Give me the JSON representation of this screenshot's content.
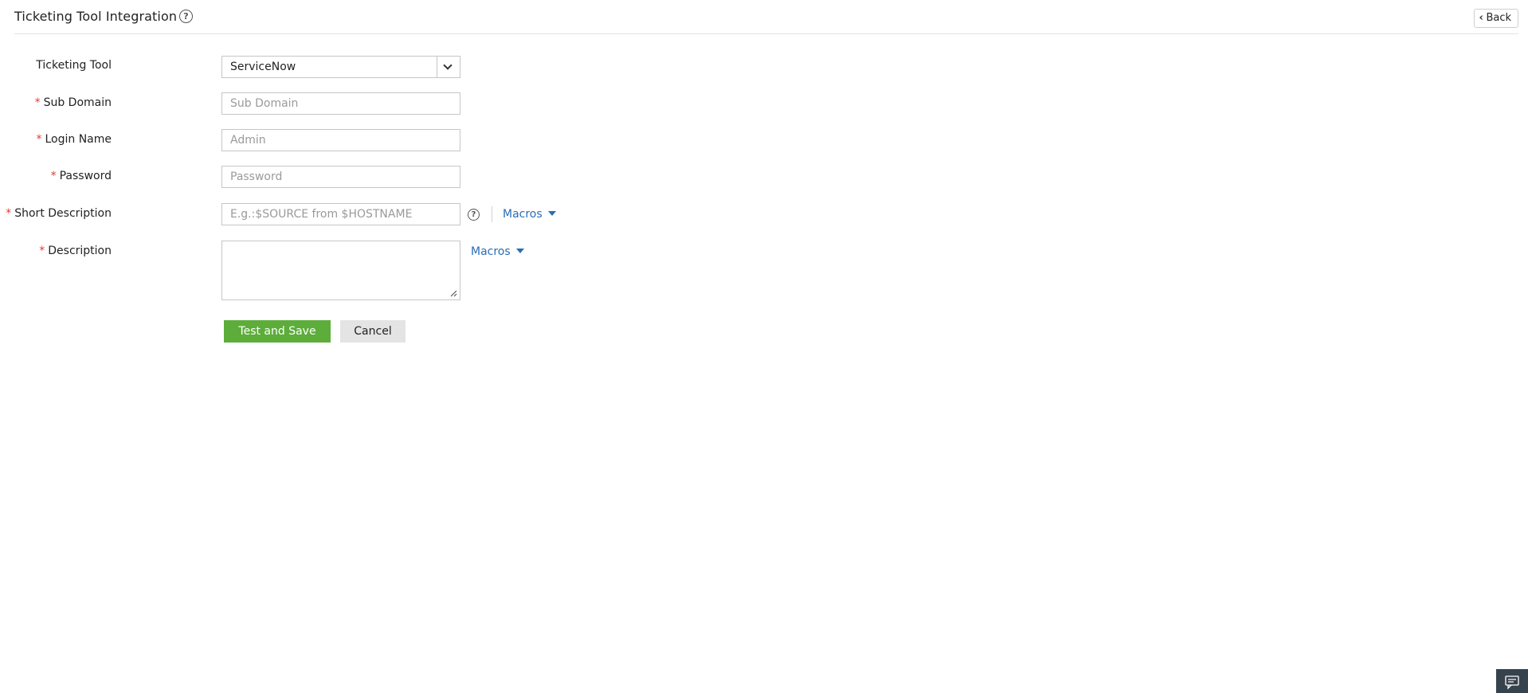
{
  "header": {
    "title": "Ticketing Tool Integration",
    "help_icon": "question-circle-icon",
    "back_label": "Back",
    "back_icon": "chevron-left-icon"
  },
  "form": {
    "ticketing_tool": {
      "label": "Ticketing Tool",
      "value": "ServiceNow"
    },
    "sub_domain": {
      "label": "Sub Domain",
      "required": "*",
      "value": "",
      "placeholder": "Sub Domain"
    },
    "login_name": {
      "label": "Login Name",
      "required": "*",
      "value": "",
      "placeholder": "Admin"
    },
    "password": {
      "label": "Password",
      "required": "*",
      "value": "",
      "placeholder": "Password"
    },
    "short_description": {
      "label": "Short Description",
      "required": "*",
      "value": "",
      "placeholder": "E.g.:$SOURCE from $HOSTNAME",
      "macros_label": "Macros"
    },
    "description": {
      "label": "Description",
      "required": "*",
      "value": "",
      "macros_label": "Macros"
    },
    "buttons": {
      "save_label": "Test and Save",
      "cancel_label": "Cancel"
    }
  },
  "colors": {
    "required": "#e53935",
    "link": "#2a6db6",
    "primary_button": "#5cad3a",
    "secondary_button": "#e4e4e4",
    "chat_widget": "#36424c"
  },
  "chat_widget": {
    "icon": "chat-bubble-icon"
  }
}
